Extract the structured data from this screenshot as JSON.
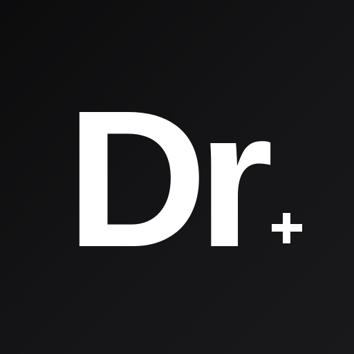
{
  "logo": {
    "text": "Dr",
    "color": "#ffffff",
    "badge_icon": "plus-icon"
  },
  "background": {
    "color": "#121214"
  }
}
